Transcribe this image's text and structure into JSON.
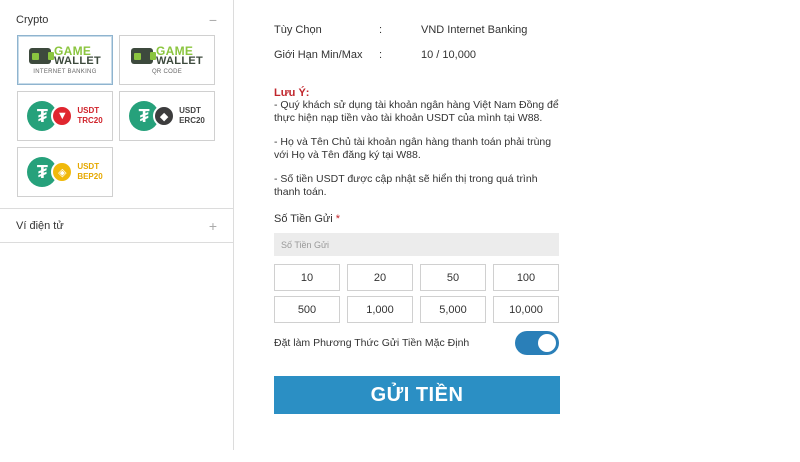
{
  "sidebar": {
    "crypto_title": "Crypto",
    "crypto_toggle": "−",
    "ewallet_title": "Ví điện tử",
    "ewallet_toggle": "+",
    "cards": [
      {
        "id": "gw-banking",
        "top": "GAME",
        "bottom": "WALLET",
        "sub": "INTERNET BANKING",
        "selected": true
      },
      {
        "id": "gw-qr",
        "top": "GAME",
        "bottom": "WALLET",
        "sub": "QR CODE",
        "selected": false
      },
      {
        "id": "usdt-trc20",
        "l1": "USDT",
        "l2": "TRC20",
        "selected": false
      },
      {
        "id": "usdt-erc20",
        "l1": "USDT",
        "l2": "ERC20",
        "selected": false
      },
      {
        "id": "usdt-bep20",
        "l1": "USDT",
        "l2": "BEP20",
        "selected": false
      }
    ]
  },
  "info": {
    "option_key": "Tùy Chọn",
    "option_colon": ":",
    "option_value": "VND Internet Banking",
    "limit_key": "Giới Hạn Min/Max",
    "limit_colon": ":",
    "limit_value": "10 / 10,000"
  },
  "notes": {
    "title": "Lưu Ý:",
    "n1": "- Quý khách sử dụng tài khoản ngân hàng Việt Nam Đồng để thực hiện nạp tiền vào tài khoản USDT của mình tại W88.",
    "n2": "- Họ và Tên Chủ tài khoản ngân hàng thanh toán phải trùng với Họ và Tên đăng ký tại W88.",
    "n3": "- Số tiền USDT được cập nhật sẽ hiển thị trong quá trình thanh toán."
  },
  "amount": {
    "label": "Số Tiền Gửi",
    "required_mark": "*",
    "placeholder": "Số Tiền Gửi",
    "chips": [
      "10",
      "20",
      "50",
      "100",
      "500",
      "1,000",
      "5,000",
      "10,000"
    ]
  },
  "default_method": {
    "label": "Đặt làm Phương Thức Gửi Tiền Mặc Định",
    "enabled": true
  },
  "submit_label": "GỬI TIỀN",
  "colors": {
    "accent": "#2b8fc4",
    "toggle_on": "#2a7fb8",
    "note_red": "#c0262c",
    "tether_green": "#26a17b"
  }
}
